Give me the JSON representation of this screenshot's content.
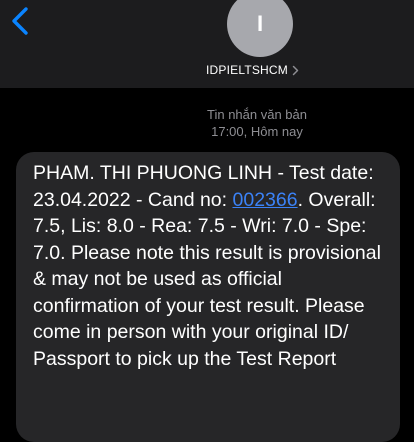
{
  "header": {
    "avatar_initial": "I",
    "contact_name": "IDPIELTSHCM",
    "accent_color": "#0a84ff"
  },
  "meta": {
    "type_label": "Tin nhắn văn bản",
    "time_label": "17:00, Hôm nay"
  },
  "message": {
    "text_before_link": "PHAM. THI PHUONG LINH - Test date: 23.04.2022 - Cand no: ",
    "link_text": "002366",
    "text_after_link": ". Overall: 7.5, Lis: 8.0 -  Rea: 7.5 - Wri: 7.0 - Spe: 7.0. Please note this result is provisional & may not be used as official confirmation of your test result.  Please come in person with your original ID/ Passport to pick up the Test Report"
  }
}
